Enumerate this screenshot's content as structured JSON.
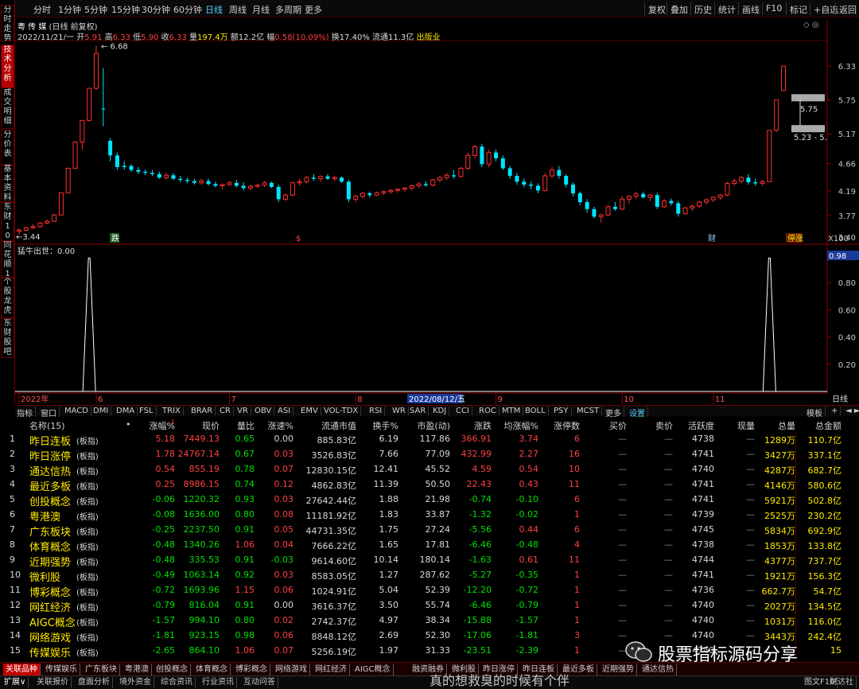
{
  "toolbar": {
    "periods": [
      "分时",
      "1分钟",
      "5分钟",
      "15分钟",
      "30分钟",
      "60分钟",
      "日线",
      "周线",
      "月线",
      "多周期",
      "更多"
    ],
    "active_period": "日线",
    "right_buttons": [
      "复权",
      "叠加",
      "历史",
      "统计",
      "画线",
      "F10",
      "标记",
      "+自选",
      "返回"
    ]
  },
  "left_tabs": [
    {
      "label": "分时走势",
      "active": false
    },
    {
      "label": "技术分析",
      "active": true
    },
    {
      "label": "成交明细",
      "active": false
    },
    {
      "label": "分价表",
      "active": false
    },
    {
      "label": "基本资料",
      "active": false
    },
    {
      "label": "东财10",
      "active": false
    },
    {
      "label": "同花顺10",
      "active": false
    },
    {
      "label": "个股龙虎",
      "active": false
    },
    {
      "label": "东财股吧",
      "active": false
    }
  ],
  "stock": {
    "name": "粤 传 媒",
    "mode": "(日线 前复权)",
    "date": "2022/11/21/一",
    "open_label": "开",
    "open": "5.91",
    "high_label": "高",
    "high": "6.33",
    "low_label": "低",
    "low": "5.90",
    "close_label": "收",
    "close": "6.33",
    "vol_label": "量",
    "vol": "197.4万",
    "amt_label": "额",
    "amt": "12.2亿",
    "chg_label": "幅",
    "chg": "0.58(10.09%)",
    "turn_label": "换",
    "turn": "17.40%",
    "float_label": "流通",
    "float": "11.3亿",
    "sector": "出版业"
  },
  "price_chart": {
    "y_labels": [
      "6.33",
      "5.75",
      "5.17",
      "4.66",
      "4.19",
      "3.77",
      "3.40"
    ],
    "max_label": "6.68",
    "min_label": "3.44",
    "price_box_1": "5.75",
    "price_box_2": "5.23 - 5.",
    "axis_mult": "X100",
    "markers": [
      "跌",
      "$",
      "财",
      "停涨"
    ],
    "candles": [
      [
        3.5,
        3.55,
        3.44,
        3.52,
        1
      ],
      [
        3.52,
        3.58,
        3.5,
        3.56,
        1
      ],
      [
        3.56,
        3.62,
        3.54,
        3.58,
        1
      ],
      [
        3.58,
        3.66,
        3.56,
        3.64,
        1
      ],
      [
        3.64,
        3.7,
        3.62,
        3.67,
        1
      ],
      [
        3.67,
        3.8,
        3.66,
        3.78,
        1
      ],
      [
        3.78,
        4.16,
        3.77,
        4.16,
        1
      ],
      [
        4.16,
        4.58,
        4.15,
        4.58,
        1
      ],
      [
        4.58,
        5.03,
        4.57,
        5.03,
        1
      ],
      [
        5.03,
        5.4,
        4.9,
        5.4,
        1
      ],
      [
        5.4,
        5.95,
        5.38,
        5.95,
        1
      ],
      [
        5.95,
        6.68,
        5.92,
        6.55,
        1
      ],
      [
        5.6,
        6.3,
        5.3,
        5.6,
        0
      ],
      [
        5.05,
        5.1,
        4.7,
        4.8,
        0
      ],
      [
        4.8,
        4.85,
        4.55,
        4.6,
        0
      ],
      [
        4.6,
        4.7,
        4.55,
        4.62,
        0
      ],
      [
        4.62,
        4.65,
        4.52,
        4.55,
        0
      ],
      [
        4.55,
        4.6,
        4.48,
        4.52,
        0
      ],
      [
        4.52,
        4.56,
        4.46,
        4.5,
        0
      ],
      [
        4.5,
        4.55,
        4.45,
        4.48,
        0
      ],
      [
        4.48,
        4.52,
        4.4,
        4.42,
        0
      ],
      [
        4.42,
        4.5,
        4.38,
        4.46,
        1
      ],
      [
        4.46,
        4.5,
        4.38,
        4.4,
        0
      ],
      [
        4.4,
        4.45,
        4.34,
        4.38,
        0
      ],
      [
        4.38,
        4.42,
        4.32,
        4.36,
        0
      ],
      [
        4.36,
        4.4,
        4.3,
        4.33,
        0
      ],
      [
        4.33,
        4.4,
        4.3,
        4.36,
        1
      ],
      [
        4.36,
        4.4,
        4.28,
        4.31,
        0
      ],
      [
        4.31,
        4.35,
        4.25,
        4.28,
        0
      ],
      [
        4.28,
        4.32,
        4.22,
        4.3,
        1
      ],
      [
        4.3,
        4.36,
        4.28,
        4.33,
        1
      ],
      [
        4.33,
        4.38,
        4.25,
        4.28,
        0
      ],
      [
        4.28,
        4.34,
        4.2,
        4.24,
        0
      ],
      [
        4.24,
        4.3,
        4.2,
        4.27,
        1
      ],
      [
        4.27,
        4.32,
        4.24,
        4.29,
        1
      ],
      [
        4.29,
        4.36,
        4.26,
        4.33,
        1
      ],
      [
        4.33,
        4.35,
        4.24,
        4.26,
        0
      ],
      [
        4.26,
        4.3,
        4.0,
        4.05,
        0
      ],
      [
        4.05,
        4.15,
        4.02,
        4.12,
        1
      ],
      [
        4.12,
        4.35,
        4.1,
        4.33,
        1
      ],
      [
        4.33,
        4.4,
        4.28,
        4.35,
        1
      ],
      [
        4.35,
        4.45,
        4.32,
        4.42,
        1
      ],
      [
        4.42,
        4.48,
        4.36,
        4.4,
        0
      ],
      [
        4.4,
        4.46,
        4.35,
        4.44,
        1
      ],
      [
        4.44,
        4.48,
        4.38,
        4.4,
        0
      ],
      [
        4.4,
        4.45,
        4.36,
        4.42,
        1
      ],
      [
        4.42,
        4.44,
        4.33,
        4.35,
        0
      ],
      [
        4.35,
        4.38,
        4.0,
        4.05,
        0
      ],
      [
        4.05,
        4.12,
        4.0,
        4.1,
        1
      ],
      [
        4.1,
        4.18,
        4.06,
        4.15,
        1
      ],
      [
        4.15,
        4.18,
        4.08,
        4.12,
        0
      ],
      [
        4.12,
        4.18,
        4.1,
        4.16,
        1
      ],
      [
        4.16,
        4.2,
        4.12,
        4.18,
        1
      ],
      [
        4.18,
        4.22,
        4.14,
        4.2,
        1
      ],
      [
        4.2,
        4.24,
        4.16,
        4.22,
        1
      ],
      [
        4.22,
        4.26,
        4.18,
        4.24,
        1
      ],
      [
        4.24,
        4.3,
        4.2,
        4.28,
        1
      ],
      [
        4.28,
        4.34,
        4.24,
        4.31,
        1
      ],
      [
        4.31,
        4.36,
        4.26,
        4.29,
        0
      ],
      [
        4.29,
        4.4,
        4.27,
        4.38,
        1
      ],
      [
        4.38,
        4.45,
        4.34,
        4.42,
        1
      ],
      [
        4.42,
        4.5,
        4.38,
        4.46,
        1
      ],
      [
        4.46,
        4.55,
        4.4,
        4.44,
        0
      ],
      [
        4.44,
        4.6,
        4.42,
        4.58,
        1
      ],
      [
        4.58,
        4.85,
        4.55,
        4.8,
        1
      ],
      [
        4.8,
        4.98,
        4.75,
        4.95,
        1
      ],
      [
        4.95,
        5.0,
        4.6,
        4.65,
        0
      ],
      [
        4.65,
        4.9,
        4.6,
        4.85,
        1
      ],
      [
        4.85,
        4.9,
        4.7,
        4.75,
        0
      ],
      [
        4.75,
        4.8,
        4.55,
        4.58,
        0
      ],
      [
        4.58,
        4.62,
        4.4,
        4.45,
        0
      ],
      [
        4.45,
        4.5,
        4.3,
        4.35,
        0
      ],
      [
        4.35,
        4.4,
        4.25,
        4.3,
        0
      ],
      [
        4.3,
        4.35,
        4.22,
        4.28,
        0
      ],
      [
        4.28,
        4.32,
        4.15,
        4.2,
        0
      ],
      [
        4.2,
        4.5,
        4.18,
        4.45,
        1
      ],
      [
        4.45,
        4.6,
        4.42,
        4.55,
        1
      ],
      [
        4.55,
        4.62,
        4.4,
        4.45,
        0
      ],
      [
        4.45,
        4.48,
        4.25,
        4.3,
        0
      ],
      [
        4.3,
        4.34,
        4.1,
        4.15,
        0
      ],
      [
        4.15,
        4.18,
        3.95,
        4.0,
        0
      ],
      [
        4.0,
        4.05,
        3.82,
        3.88,
        0
      ],
      [
        3.88,
        3.92,
        3.72,
        3.75,
        0
      ],
      [
        3.75,
        3.8,
        3.65,
        3.78,
        1
      ],
      [
        3.78,
        3.95,
        3.76,
        3.92,
        1
      ],
      [
        3.92,
        4.0,
        3.85,
        3.88,
        0
      ],
      [
        3.88,
        4.1,
        3.86,
        4.05,
        1
      ],
      [
        4.05,
        4.12,
        3.98,
        4.1,
        1
      ],
      [
        4.1,
        4.18,
        4.05,
        4.14,
        1
      ],
      [
        4.14,
        4.18,
        4.06,
        4.08,
        0
      ],
      [
        4.08,
        4.14,
        4.02,
        4.12,
        1
      ],
      [
        4.12,
        4.16,
        3.88,
        3.92,
        0
      ],
      [
        3.92,
        4.05,
        3.9,
        4.02,
        1
      ],
      [
        4.02,
        4.06,
        3.94,
        3.98,
        0
      ],
      [
        3.98,
        4.02,
        3.75,
        3.8,
        0
      ],
      [
        3.8,
        3.92,
        3.78,
        3.9,
        1
      ],
      [
        3.9,
        3.96,
        3.85,
        3.93,
        1
      ],
      [
        3.93,
        4.02,
        3.9,
        4.0,
        1
      ],
      [
        4.0,
        4.06,
        3.96,
        4.04,
        1
      ],
      [
        4.04,
        4.1,
        4.0,
        4.08,
        1
      ],
      [
        4.08,
        4.14,
        4.04,
        4.12,
        1
      ],
      [
        4.12,
        4.35,
        4.1,
        4.32,
        1
      ],
      [
        4.32,
        4.4,
        4.28,
        4.36,
        1
      ],
      [
        4.36,
        4.45,
        4.32,
        4.42,
        1
      ],
      [
        4.42,
        4.48,
        4.3,
        4.34,
        0
      ],
      [
        4.34,
        4.4,
        4.28,
        4.32,
        0
      ],
      [
        4.32,
        4.38,
        4.28,
        4.35,
        1
      ],
      [
        4.35,
        5.23,
        4.34,
        5.23,
        1
      ],
      [
        5.23,
        5.75,
        5.2,
        5.75,
        1
      ],
      [
        5.91,
        6.33,
        5.9,
        6.33,
        1
      ]
    ]
  },
  "indicator": {
    "label": "猛牛出世：0.00",
    "right_value": "0.98",
    "y_labels": [
      "0.80",
      "0.60",
      "0.40",
      "0.20"
    ],
    "spikes": [
      10,
      107
    ]
  },
  "x_axis": {
    "labels": [
      {
        "text": "2022年",
        "i": 0
      },
      {
        "text": "6",
        "i": 11
      },
      {
        "text": "7",
        "i": 30
      },
      {
        "text": "8",
        "i": 48
      },
      {
        "text": "9",
        "i": 68
      },
      {
        "text": "10",
        "i": 86
      },
      {
        "text": "11",
        "i": 99
      }
    ],
    "highlight": "2022/08/12/五",
    "right_label": "日线"
  },
  "indicator_tabs": [
    "指标",
    "窗口",
    "MACD",
    "DMI",
    "DMA",
    "FSL",
    "TRIX",
    "BRAR",
    "CR",
    "VR",
    "OBV",
    "ASI",
    "EMV",
    "VOL-TDX",
    "RSI",
    "WR",
    "SAR",
    "KDJ",
    "CCI",
    "ROC",
    "MTM",
    "BOLL",
    "PSY",
    "MCST",
    "更多",
    "设置"
  ],
  "template_tab": "模板",
  "table": {
    "headers": [
      "名称(15)",
      "•",
      "涨幅%",
      "现价",
      "量比",
      "涨速%",
      "流通市值",
      "换手%",
      "市盈(动)",
      "涨跌",
      "均涨幅%",
      "涨停数",
      "买价",
      "卖价",
      "活跃度",
      "现量",
      "总量",
      "总金额"
    ],
    "rows": [
      {
        "n": "1",
        "name": "昨日连板",
        "tag": "(板指)",
        "chg": "5.18",
        "price": "7449.13",
        "lb": "0.65",
        "spd": "0.00",
        "mv": "885.83亿",
        "turn": "6.19",
        "pe": "117.86",
        "diff": "366.91",
        "avg": "3.74",
        "lim": "6",
        "buy": "—",
        "sell": "—",
        "act": "4738",
        "cur": "—",
        "vol": "1289万",
        "amt": "110.7亿"
      },
      {
        "n": "2",
        "name": "昨日涨停",
        "tag": "(板指)",
        "chg": "1.78",
        "price": "24767.14",
        "lb": "0.67",
        "spd": "0.03",
        "mv": "3526.83亿",
        "turn": "7.66",
        "pe": "77.09",
        "diff": "432.99",
        "avg": "2.27",
        "lim": "16",
        "buy": "—",
        "sell": "—",
        "act": "4741",
        "cur": "—",
        "vol": "3427万",
        "amt": "337.1亿"
      },
      {
        "n": "3",
        "name": "通达信热",
        "tag": "(板指)",
        "chg": "0.54",
        "price": "855.19",
        "lb": "0.78",
        "spd": "0.07",
        "mv": "12830.15亿",
        "turn": "12.41",
        "pe": "45.52",
        "diff": "4.59",
        "avg": "0.54",
        "lim": "10",
        "buy": "—",
        "sell": "—",
        "act": "4740",
        "cur": "—",
        "vol": "4287万",
        "amt": "682.7亿"
      },
      {
        "n": "4",
        "name": "最近多板",
        "tag": "(板指)",
        "chg": "0.25",
        "price": "8986.15",
        "lb": "0.74",
        "spd": "0.12",
        "mv": "4862.83亿",
        "turn": "11.39",
        "pe": "50.50",
        "diff": "22.43",
        "avg": "0.43",
        "lim": "11",
        "buy": "—",
        "sell": "—",
        "act": "4741",
        "cur": "—",
        "vol": "4146万",
        "amt": "580.6亿"
      },
      {
        "n": "5",
        "name": "创投概念",
        "tag": "(板指)",
        "chg": "-0.06",
        "price": "1220.32",
        "lb": "0.93",
        "spd": "0.03",
        "mv": "27642.44亿",
        "turn": "1.88",
        "pe": "21.98",
        "diff": "-0.74",
        "avg": "-0.10",
        "lim": "6",
        "buy": "—",
        "sell": "—",
        "act": "4741",
        "cur": "—",
        "vol": "5921万",
        "amt": "502.8亿"
      },
      {
        "n": "6",
        "name": "粤港澳",
        "tag": "(板指)",
        "chg": "-0.08",
        "price": "1636.00",
        "lb": "0.80",
        "spd": "0.08",
        "mv": "11181.92亿",
        "turn": "1.83",
        "pe": "33.87",
        "diff": "-1.32",
        "avg": "-0.02",
        "lim": "1",
        "buy": "—",
        "sell": "—",
        "act": "4739",
        "cur": "—",
        "vol": "2525万",
        "amt": "230.2亿"
      },
      {
        "n": "7",
        "name": "广东板块",
        "tag": "(板指)",
        "chg": "-0.25",
        "price": "2237.50",
        "lb": "0.91",
        "spd": "0.05",
        "mv": "44731.35亿",
        "turn": "1.75",
        "pe": "27.24",
        "diff": "-5.56",
        "avg": "0.44",
        "lim": "6",
        "buy": "—",
        "sell": "—",
        "act": "4745",
        "cur": "—",
        "vol": "5834万",
        "amt": "692.9亿"
      },
      {
        "n": "8",
        "name": "体育概念",
        "tag": "(板指)",
        "chg": "-0.48",
        "price": "1340.26",
        "lb": "1.06",
        "spd": "0.04",
        "mv": "7666.22亿",
        "turn": "1.65",
        "pe": "17.81",
        "diff": "-6.46",
        "avg": "-0.48",
        "lim": "4",
        "buy": "—",
        "sell": "—",
        "act": "4738",
        "cur": "—",
        "vol": "1853万",
        "amt": "133.8亿"
      },
      {
        "n": "9",
        "name": "近期强势",
        "tag": "(板指)",
        "chg": "-0.48",
        "price": "335.53",
        "lb": "0.91",
        "spd": "-0.03",
        "mv": "9614.60亿",
        "turn": "10.14",
        "pe": "180.14",
        "diff": "-1.63",
        "avg": "0.61",
        "lim": "11",
        "buy": "—",
        "sell": "—",
        "act": "4744",
        "cur": "—",
        "vol": "4377万",
        "amt": "737.7亿"
      },
      {
        "n": "10",
        "name": "微利股",
        "tag": "(板指)",
        "chg": "-0.49",
        "price": "1063.14",
        "lb": "0.92",
        "spd": "0.03",
        "mv": "8583.05亿",
        "turn": "1.27",
        "pe": "287.62",
        "diff": "-5.27",
        "avg": "-0.35",
        "lim": "1",
        "buy": "—",
        "sell": "—",
        "act": "4741",
        "cur": "—",
        "vol": "1921万",
        "amt": "156.3亿"
      },
      {
        "n": "11",
        "name": "博彩概念",
        "tag": "(板指)",
        "chg": "-0.72",
        "price": "1693.96",
        "lb": "1.15",
        "spd": "0.06",
        "mv": "1024.91亿",
        "turn": "5.04",
        "pe": "52.39",
        "diff": "-12.20",
        "avg": "-0.72",
        "lim": "1",
        "buy": "—",
        "sell": "—",
        "act": "4736",
        "cur": "—",
        "vol": "662.7万",
        "amt": "54.7亿"
      },
      {
        "n": "12",
        "name": "网红经济",
        "tag": "(板指)",
        "chg": "-0.79",
        "price": "816.04",
        "lb": "0.91",
        "spd": "0.00",
        "mv": "3616.37亿",
        "turn": "3.50",
        "pe": "55.74",
        "diff": "-6.46",
        "avg": "-0.79",
        "lim": "1",
        "buy": "—",
        "sell": "—",
        "act": "4740",
        "cur": "—",
        "vol": "2027万",
        "amt": "134.5亿"
      },
      {
        "n": "13",
        "name": "AIGC概念",
        "tag": "(板指)",
        "chg": "-1.57",
        "price": "994.10",
        "lb": "0.80",
        "spd": "0.02",
        "mv": "2742.37亿",
        "turn": "4.97",
        "pe": "38.34",
        "diff": "-15.88",
        "avg": "-1.57",
        "lim": "1",
        "buy": "—",
        "sell": "—",
        "act": "4740",
        "cur": "—",
        "vol": "1031万",
        "amt": "116.0亿"
      },
      {
        "n": "14",
        "name": "网络游戏",
        "tag": "(板指)",
        "chg": "-1.81",
        "price": "923.15",
        "lb": "0.98",
        "spd": "0.06",
        "mv": "8848.12亿",
        "turn": "2.69",
        "pe": "52.30",
        "diff": "-17.06",
        "avg": "-1.81",
        "lim": "3",
        "buy": "—",
        "sell": "—",
        "act": "4740",
        "cur": "—",
        "vol": "3443万",
        "amt": "242.4亿"
      },
      {
        "n": "15",
        "name": "传媒娱乐",
        "tag": "(板指)",
        "chg": "-2.65",
        "price": "864.10",
        "lb": "1.06",
        "spd": "0.07",
        "mv": "5256.19亿",
        "turn": "1.97",
        "pe": "31.33",
        "diff": "-23.51",
        "avg": "-2.39",
        "lim": "1",
        "buy": "—",
        "sell": "—",
        "act": "4740",
        "cur": "—",
        "vol": "",
        "amt": "15"
      }
    ]
  },
  "bottom_tabs": [
    "关联品种",
    "传媒娱乐",
    "广东板块",
    "粤港澳",
    "创投概念",
    "体育概念",
    "博彩概念",
    "网络游戏",
    "网红经济",
    "AIGC概念",
    "融资融券",
    "微利股",
    "昨日涨停",
    "昨日连板",
    "最近多板",
    "近期强势",
    "通达信热"
  ],
  "bottom_tab_active": "关联品种",
  "status_bar": [
    "扩展∨",
    "关联报价",
    "盘面分析",
    "境外资金",
    "综合资讯",
    "行业资讯",
    "互动问答"
  ],
  "status_right": [
    "图文F10",
    "财达社"
  ],
  "watermark": {
    "text": "股票指标源码分享",
    "sub": "真的想救臭的时候有个伴"
  },
  "colors": {
    "up": "#ff3030",
    "down": "#00e5ff",
    "ma": "#ffffff",
    "frame": "#8b0000"
  }
}
